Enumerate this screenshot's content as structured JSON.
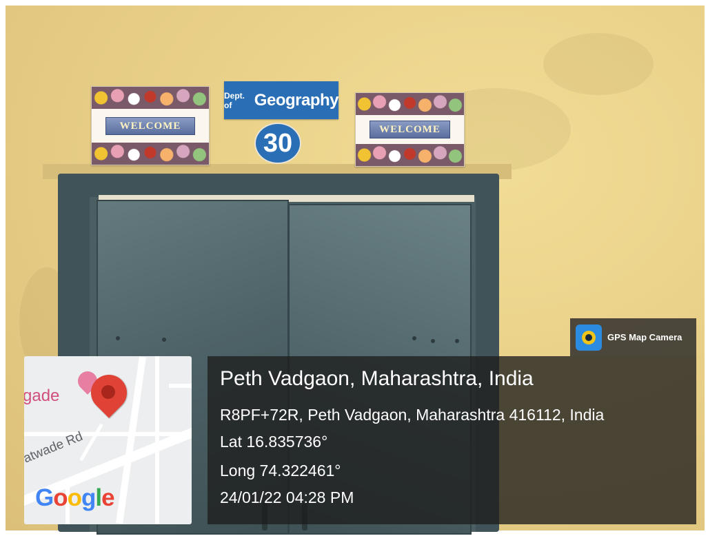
{
  "signs": {
    "dept_prefix": "Dept. of",
    "dept_name": "Geography",
    "room_number": "30",
    "welcome_left": "WELCOME",
    "welcome_right": "WELCOME"
  },
  "gps_camera": {
    "app_name": "GPS Map Camera",
    "icon": "gps-map-camera-logo-icon"
  },
  "location": {
    "place": "Peth Vadgaon, Maharashtra, India",
    "address": "R8PF+72R, Peth Vadgaon, Maharashtra 416112, India",
    "latitude": "Lat 16.835736°",
    "longitude": "Long 74.322461°",
    "timestamp": "24/01/22 04:28 PM"
  },
  "map": {
    "place_label": "gade",
    "road_label": "atwade Rd",
    "brand": "Google",
    "pin_icon": "location-pin-icon",
    "colors": {
      "pin": "#e04336",
      "place": "#d14f7c"
    }
  }
}
